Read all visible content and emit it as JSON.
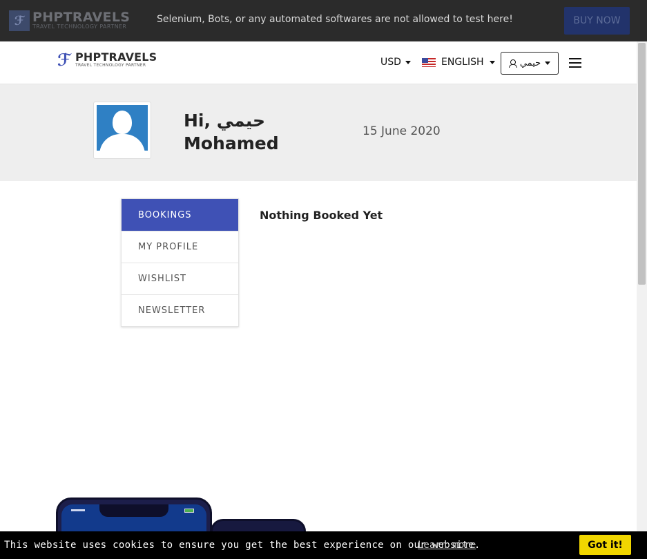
{
  "topbar": {
    "logo_title": "PHPTRAVELS",
    "logo_sub": "TRAVEL TECHNOLOGY PARTNER",
    "message": "Selenium, Bots, or any automated softwares are not allowed to test here!",
    "buy_label": "BUY NOW"
  },
  "nav": {
    "logo_title": "PHPTRAVELS",
    "logo_sub": "TRAVEL TECHNOLOGY PARTNER",
    "currency": "USD",
    "language": "ENGLISH",
    "user_label": "حيمي"
  },
  "profile": {
    "greeting": "Hi, حيمي Mohamed",
    "date": "15 June 2020"
  },
  "menu": {
    "items": [
      {
        "label": "BOOKINGS"
      },
      {
        "label": "MY PROFILE"
      },
      {
        "label": "WISHLIST"
      },
      {
        "label": "NEWSLETTER"
      }
    ]
  },
  "main": {
    "empty_message": "Nothing Booked Yet"
  },
  "cookie": {
    "text": "This website uses cookies to ensure you get the best experience on our website.",
    "link": "Learn more",
    "button": "Got it!"
  },
  "colors": {
    "accent": "#3f51b5",
    "topbar": "#2b2b2b",
    "cookie_button": "#f1d600"
  }
}
